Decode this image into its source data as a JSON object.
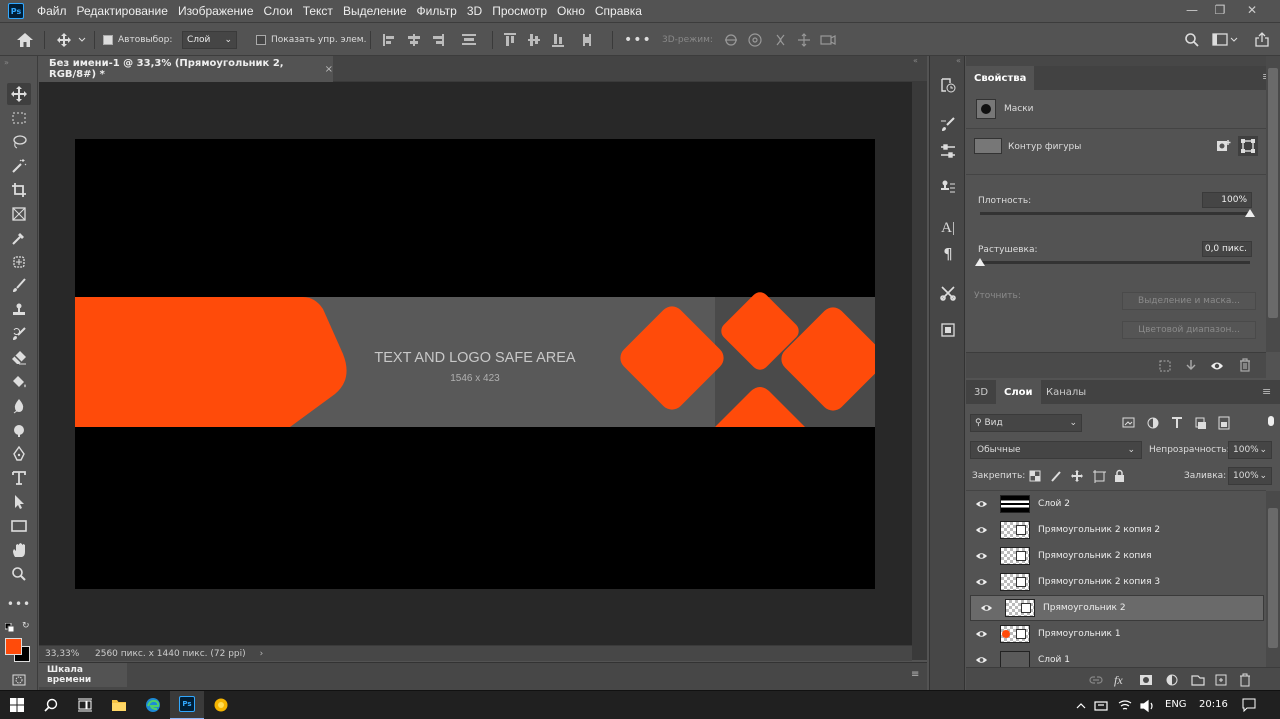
{
  "app": {
    "name": "Photoshop",
    "logo": "Ps"
  },
  "menu": [
    "Файл",
    "Редактирование",
    "Изображение",
    "Слои",
    "Текст",
    "Выделение",
    "Фильтр",
    "3D",
    "Просмотр",
    "Окно",
    "Справка"
  ],
  "options": {
    "autoselect_label": "Автовыбор:",
    "autoselect_value": "Слой",
    "show_controls_label": "Показать упр. элем.",
    "mode3d_label": "3D-режим:"
  },
  "document": {
    "tab_title": "Без имени-1 @ 33,3% (Прямоугольник 2, RGB/8#) *",
    "banner_text": "TEXT AND LOGO SAFE AREA",
    "banner_size": "1546 x 423",
    "zoom": "33,33%",
    "doc_info": "2560 пикс. x 1440 пикс. (72 ppi)",
    "canvas_bg": "#282828",
    "accent": "#ff4b0a",
    "band_gray": "#595959"
  },
  "timeline": {
    "label": "Шкала времени"
  },
  "properties": {
    "tab": "Свойства",
    "masks_label": "Маски",
    "shape_path_label": "Контур фигуры",
    "density_label": "Плотность:",
    "density_value": "100%",
    "feather_label": "Растушевка:",
    "feather_value": "0,0 пикс.",
    "refine_label": "Уточнить:",
    "select_mask_btn": "Выделение и маска...",
    "color_range_btn": "Цветовой диапазон..."
  },
  "layers_panel": {
    "tabs": [
      "3D",
      "Слои",
      "Каналы"
    ],
    "active_tab": "Слои",
    "filter_kind": "Вид",
    "blend_mode": "Обычные",
    "opacity_label": "Непрозрачность:",
    "opacity_value": "100%",
    "lock_label": "Закрепить:",
    "fill_label": "Заливка:",
    "fill_value": "100%",
    "layers": [
      {
        "name": "Слой 2",
        "kind": "stripes"
      },
      {
        "name": "Прямоугольник 2 копия 2",
        "kind": "shape"
      },
      {
        "name": "Прямоугольник 2 копия",
        "kind": "shape"
      },
      {
        "name": "Прямоугольник 2 копия 3",
        "kind": "shape"
      },
      {
        "name": "Прямоугольник 2",
        "kind": "shape",
        "selected": true
      },
      {
        "name": "Прямоугольник 1",
        "kind": "shape-orange"
      },
      {
        "name": "Слой 1",
        "kind": "gray"
      }
    ]
  },
  "taskbar": {
    "language": "ENG",
    "time": "20:16"
  }
}
